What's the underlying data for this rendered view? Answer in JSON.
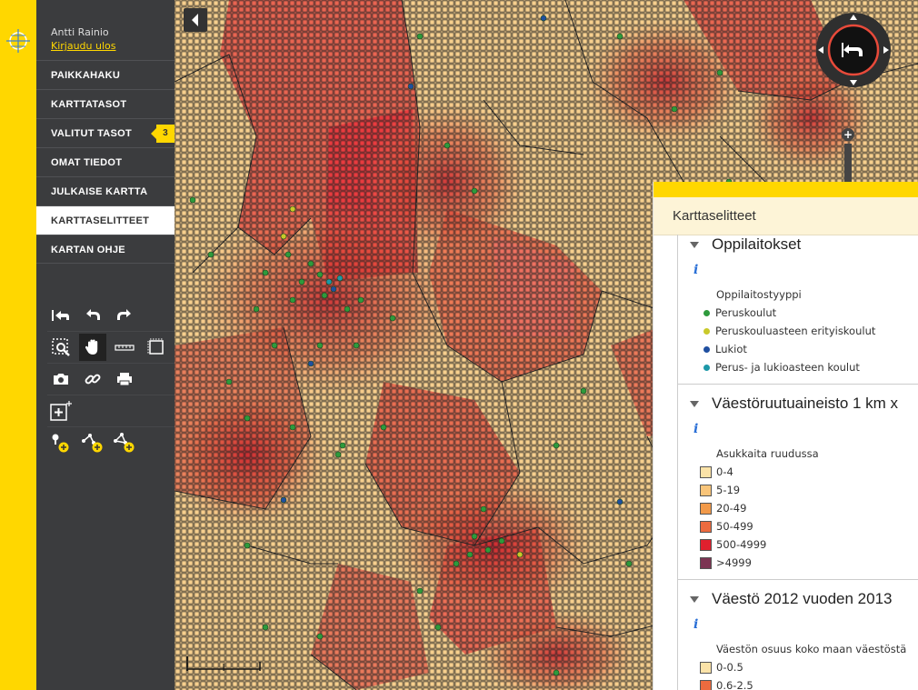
{
  "user": {
    "name": "Antti Rainio",
    "logout": "Kirjaudu ulos"
  },
  "nav": {
    "items": [
      {
        "label": "PAIKKAHAKU"
      },
      {
        "label": "KARTTATASOT"
      },
      {
        "label": "VALITUT TASOT",
        "badge": "3"
      },
      {
        "label": "OMAT TIEDOT"
      },
      {
        "label": "JULKAISE KARTTA"
      },
      {
        "label": "KARTTASELITTEET",
        "active": true
      },
      {
        "label": "KARTAN OHJE"
      }
    ]
  },
  "tools": {
    "row1": [
      "reset-view-icon",
      "undo-icon",
      "redo-icon"
    ],
    "row2": [
      "zoom-box-icon",
      "pan-hand-icon",
      "measure-line-icon",
      "measure-area-icon"
    ],
    "row3": [
      "camera-icon",
      "link-icon",
      "print-icon"
    ],
    "row4": [
      "add-layer-icon"
    ],
    "row5": [
      "add-point-icon",
      "add-line-icon",
      "add-area-icon"
    ]
  },
  "legend": {
    "header": "Karttaselitteet",
    "sections": [
      {
        "title": "Oppilaitokset",
        "info": "i",
        "subtitle": "Oppilaitostyyppi",
        "items": [
          {
            "label": "Peruskoulut",
            "color": "#2e9a3c"
          },
          {
            "label": "Peruskouluasteen erityiskoulut",
            "color": "#c9c92a"
          },
          {
            "label": "Lukiot",
            "color": "#1f4fa0"
          },
          {
            "label": "Perus- ja lukioasteen koulut",
            "color": "#1c98a8"
          }
        ]
      },
      {
        "title": "Väestöruutuaineisto 1 km x",
        "info": "i",
        "subtitle": "Asukkaita ruudussa",
        "items": [
          {
            "label": "0-4",
            "color": "#fbe3a8"
          },
          {
            "label": "5-19",
            "color": "#f9c57a"
          },
          {
            "label": "20-49",
            "color": "#f29a4a"
          },
          {
            "label": "50-499",
            "color": "#ec6b3f"
          },
          {
            "label": "500-4999",
            "color": "#e0202e"
          },
          {
            "label": ">4999",
            "color": "#7c3553"
          }
        ]
      },
      {
        "title": "Väestö 2012 vuoden 2013",
        "info": "i",
        "subtitle": "Väestön osuus koko maan väestöstä",
        "items": [
          {
            "label": "0-0.5",
            "color": "#fbe3a8"
          },
          {
            "label": "0.6-2.5",
            "color": "#ec6b3f"
          }
        ]
      }
    ]
  },
  "colors": {
    "accent": "#ffd700",
    "sidebar": "#3b3c3e"
  }
}
